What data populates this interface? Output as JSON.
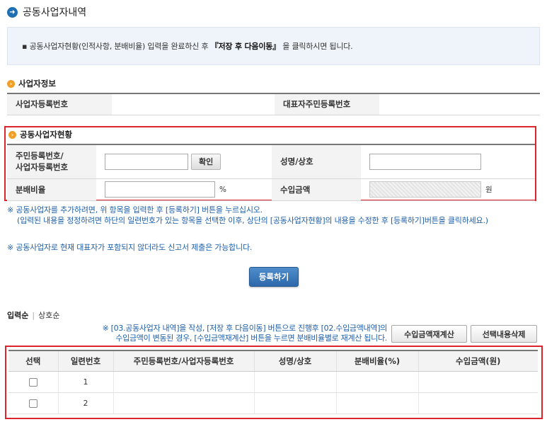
{
  "header": {
    "title": "공동사업자내역",
    "icon": "circle-arrow-icon"
  },
  "notice": {
    "bullet": "▪",
    "prefix": "공동사업자현황(인적사항, 분배비율) 입력을 완료하신 후 ",
    "highlight": "『저장 후 다음이동』",
    "suffix": " 을 클릭하시면 됩니다."
  },
  "business_info": {
    "title": "사업자정보",
    "reg_no_label": "사업자등록번호",
    "reg_no_value": "",
    "rep_id_label": "대표자주민등록번호",
    "rep_id_value": ""
  },
  "joint_status": {
    "title": "공동사업자현황",
    "id_label_line1": "주민등록번호/",
    "id_label_line2": "사업자등록번호",
    "id_value": "",
    "confirm_button": "확인",
    "name_label": "성명/상호",
    "name_value": "",
    "ratio_label": "분배비율",
    "ratio_value": "",
    "ratio_unit": "%",
    "income_label": "수입금액",
    "income_value": "",
    "income_unit": "원"
  },
  "notes": {
    "line1": "※ 공동사업자를 추가하려면, 위 항목을 입력한 후 [등록하기] 버튼을 누르십시오.",
    "line2": "(입력된 내용을 정정하려면 하단의 일련번호가 있는 항목을 선택한 이후, 상단의 [공동사업자현황]의 내용을 수정한 후 [등록하기]버튼을 클릭하세요.)",
    "line3": "※ 공동사업자로 현재 대표자가 포함되지 않더라도 신고서 제출은 가능합니다."
  },
  "register_button": "등록하기",
  "sort": {
    "active": "입력순",
    "separator": "|",
    "inactive": "상호순"
  },
  "hint": {
    "line1": "※ [03.공동사업자 내역]을 작성, [저장 후 다음이동] 버튼으로 진행후 [02.수입금액내역]의",
    "line2": "수입금액이 변동된 경우, [수입금액재계산] 버튼을 누르면 분배비율별로 재계산 됩니다."
  },
  "recalc_button": "수입금액재계산",
  "delete_button": "선택내용삭제",
  "list": {
    "columns": [
      "선택",
      "일련번호",
      "주민등록번호/사업자등록번호",
      "성명/상호",
      "분배비율(%)",
      "수입금액(원)"
    ],
    "rows": [
      {
        "serial": "1",
        "id": "",
        "name": "",
        "ratio": "",
        "income": ""
      },
      {
        "serial": "2",
        "id": "",
        "name": "",
        "ratio": "",
        "income": ""
      }
    ]
  },
  "colors": {
    "highlight_border": "#d9252b",
    "note_text": "#1e5fa8",
    "primary_button": "#2d69ab",
    "section_icon": "#f0a028"
  }
}
